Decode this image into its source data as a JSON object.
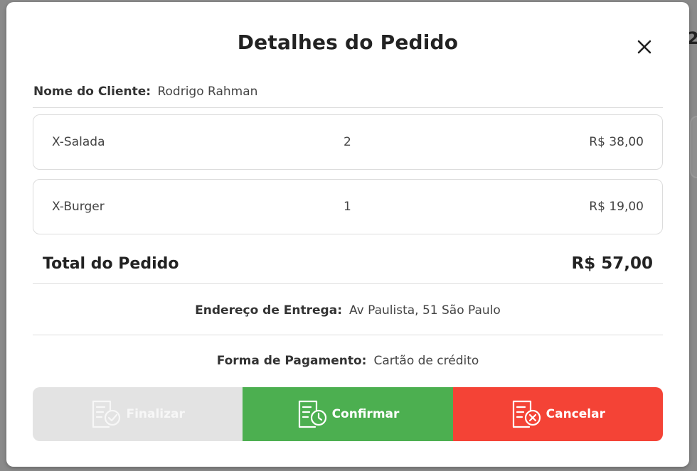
{
  "modal": {
    "title": "Detalhes do Pedido",
    "close_icon": "close-icon"
  },
  "client": {
    "label": "Nome do Cliente:",
    "name": "Rodrigo Rahman"
  },
  "items": [
    {
      "name": "X-Salada",
      "quantity": "2",
      "price": "R$ 38,00"
    },
    {
      "name": "X-Burger",
      "quantity": "1",
      "price": "R$ 19,00"
    }
  ],
  "total": {
    "label": "Total do Pedido",
    "value": "R$ 57,00"
  },
  "delivery": {
    "label": "Endereço de Entrega:",
    "value": "Av Paulista, 51 São Paulo"
  },
  "payment": {
    "label": "Forma de Pagamento:",
    "value": "Cartão de crédito"
  },
  "actions": {
    "finalize": {
      "label": "Finalizar",
      "icon": "document-check-icon",
      "color": "#e3e3e3"
    },
    "confirm": {
      "label": "Confirmar",
      "icon": "document-clock-icon",
      "color": "#4caf50"
    },
    "cancel": {
      "label": "Cancelar",
      "icon": "document-x-icon",
      "color": "#f44336"
    }
  }
}
